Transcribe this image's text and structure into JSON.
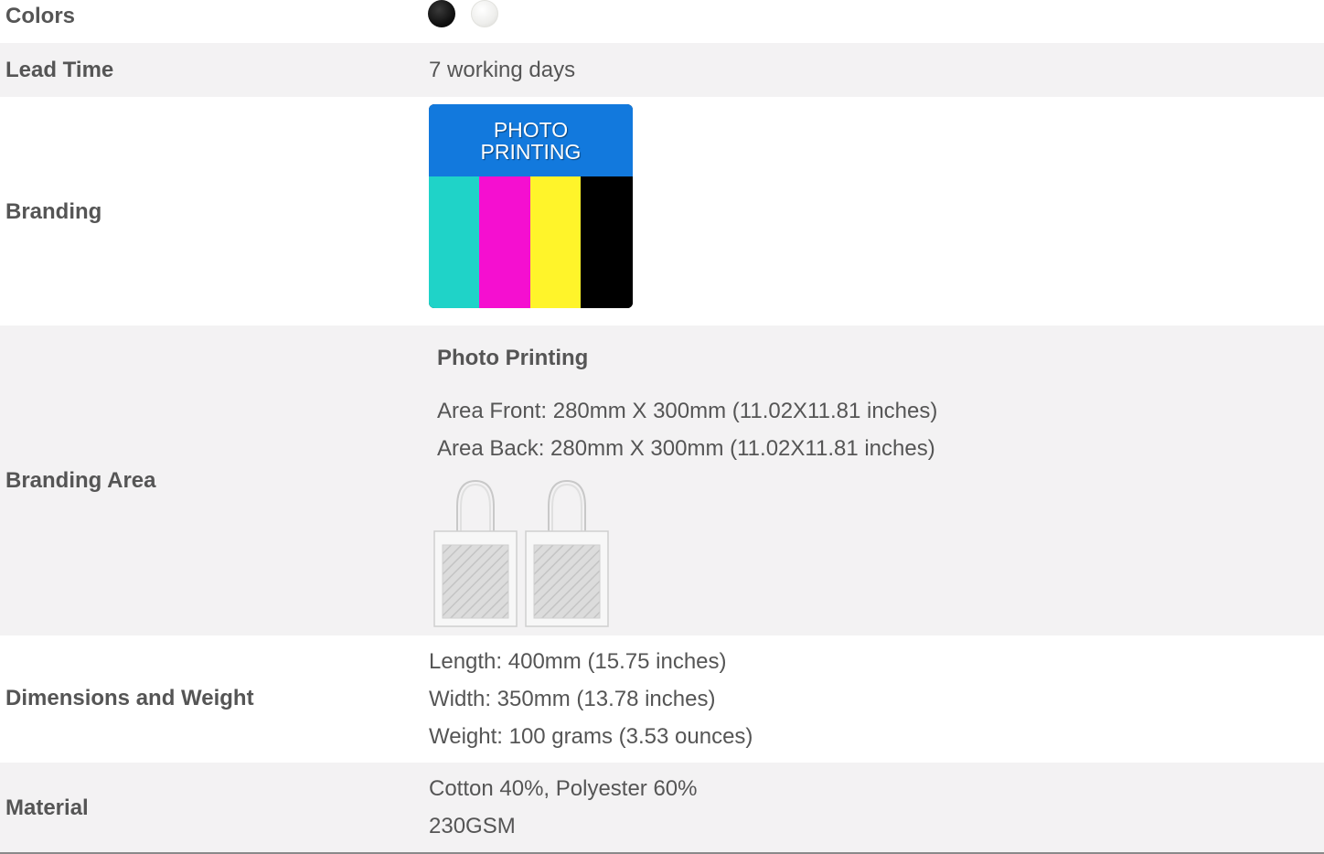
{
  "rows": {
    "colors": {
      "label": "Colors",
      "swatches": [
        {
          "name": "Black",
          "color": "#000000"
        },
        {
          "name": "White",
          "color": "#f4f4f2"
        }
      ]
    },
    "lead_time": {
      "label": "Lead Time",
      "value": "7 working days"
    },
    "branding": {
      "label": "Branding",
      "tile_line1": "PHOTO",
      "tile_line2": "PRINTING",
      "tile_header_color": "#1279dd",
      "stripe_colors": [
        "#1fd3c8",
        "#f50fd0",
        "#fff42a",
        "#000000"
      ]
    },
    "branding_area": {
      "label": "Branding Area",
      "method": "Photo Printing",
      "front": "Area Front: 280mm X 300mm (11.02X11.81 inches)",
      "back": "Area Back: 280mm X 300mm (11.02X11.81 inches)",
      "bag_images": [
        "tote-bag-front",
        "tote-bag-back"
      ]
    },
    "dimensions": {
      "label": "Dimensions and Weight",
      "length": "Length: 400mm (15.75 inches)",
      "width": "Width: 350mm (13.78 inches)",
      "weight": "Weight: 100 grams (3.53 ounces)"
    },
    "material": {
      "label": "Material",
      "composition": "Cotton 40%, Polyester 60%",
      "gsm": "230GSM"
    }
  }
}
